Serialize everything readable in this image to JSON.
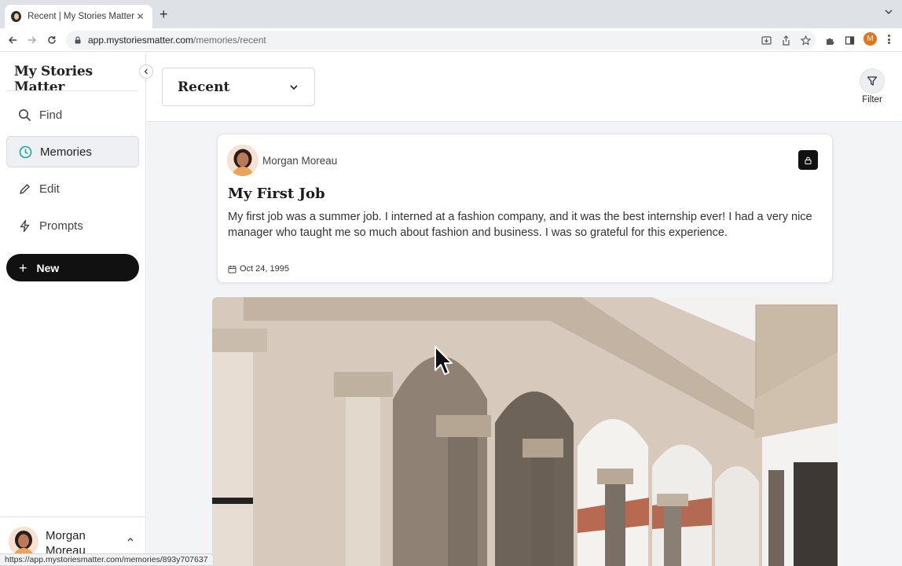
{
  "browser": {
    "tab_title": "Recent | My Stories Matter",
    "url_host": "app.mystoriesmatter.com",
    "url_path": "/memories/recent",
    "profile_initial": "M",
    "status_url": "https://app.mystoriesmatter.com/memories/893y707637"
  },
  "sidebar": {
    "brand": "My Stories Matter",
    "items": [
      {
        "label": "Find",
        "icon": "search-icon"
      },
      {
        "label": "Memories",
        "icon": "clock-icon",
        "active": true
      },
      {
        "label": "Edit",
        "icon": "pencil-icon"
      },
      {
        "label": "Prompts",
        "icon": "lightning-icon"
      }
    ],
    "new_label": "New",
    "user_name": "Morgan Moreau"
  },
  "header": {
    "view_label": "Recent",
    "filter_label": "Filter"
  },
  "memory": {
    "author": "Morgan Moreau",
    "title": "My First Job",
    "body": "My first job was a summer job. I interned at a fashion company, and it was the best internship ever! I had a very nice manager who taught me so much about fashion and business. I was so grateful for this experience.",
    "date": "Oct 24, 1995"
  },
  "colors": {
    "accent": "#1aa7a0",
    "primary_button": "#111111",
    "profile": "#e8711a"
  }
}
